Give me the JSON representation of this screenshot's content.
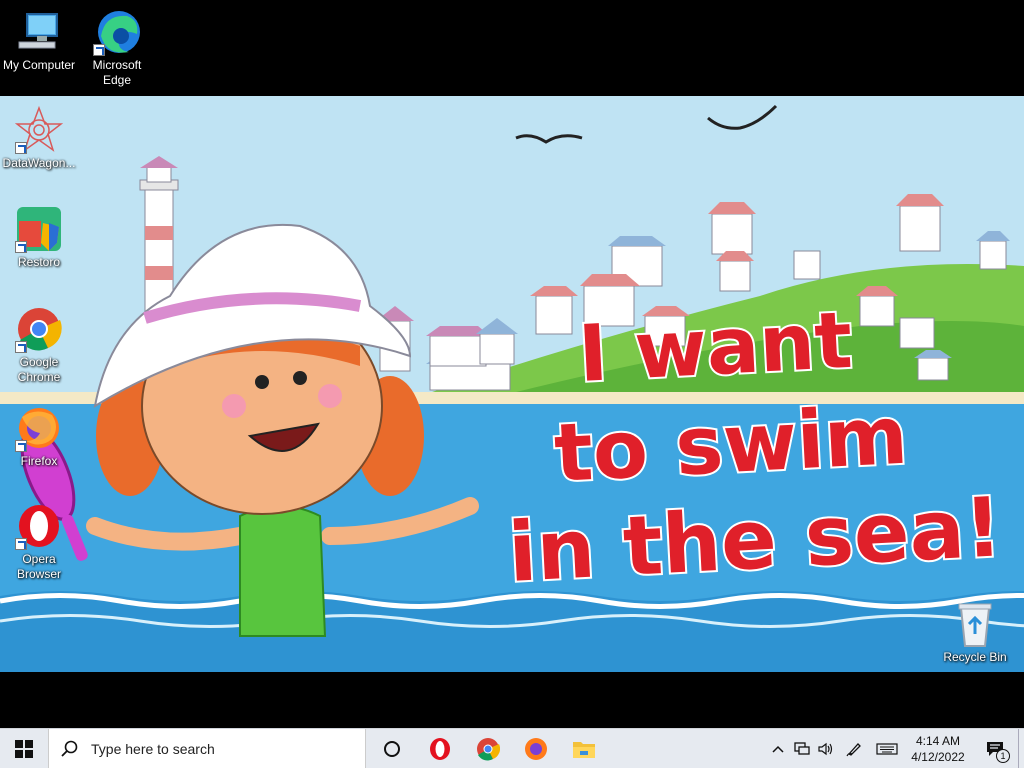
{
  "desktop": {
    "icons": [
      {
        "label": "My Computer",
        "icon": "computer-icon"
      },
      {
        "label": "Microsoft Edge",
        "icon": "edge-icon"
      },
      {
        "label": "DataWagon...",
        "icon": "datawagon-icon"
      },
      {
        "label": "Restoro",
        "icon": "restoro-icon"
      },
      {
        "label": "Google Chrome",
        "icon": "chrome-icon"
      },
      {
        "label": "Firefox",
        "icon": "firefox-icon"
      },
      {
        "label": "Opera Browser",
        "icon": "opera-icon"
      },
      {
        "label": "Recycle Bin",
        "icon": "recycle-bin-icon"
      }
    ]
  },
  "wallpaper": {
    "line1": "I want",
    "line2": "to swim",
    "line3": "in the sea!"
  },
  "taskbar": {
    "search_placeholder": "Type here to search",
    "pinned": [
      "cortana-icon",
      "opera-icon",
      "chrome-icon",
      "firefox-icon",
      "file-explorer-icon"
    ],
    "clock_time": "4:14 AM",
    "clock_date": "4/12/2022",
    "notification_count": "1"
  },
  "colors": {
    "taskbar_bg": "#e6eaf0",
    "sea": "#3fa6e0",
    "sky": "#bfe3f3",
    "title_red": "#e0202a"
  }
}
